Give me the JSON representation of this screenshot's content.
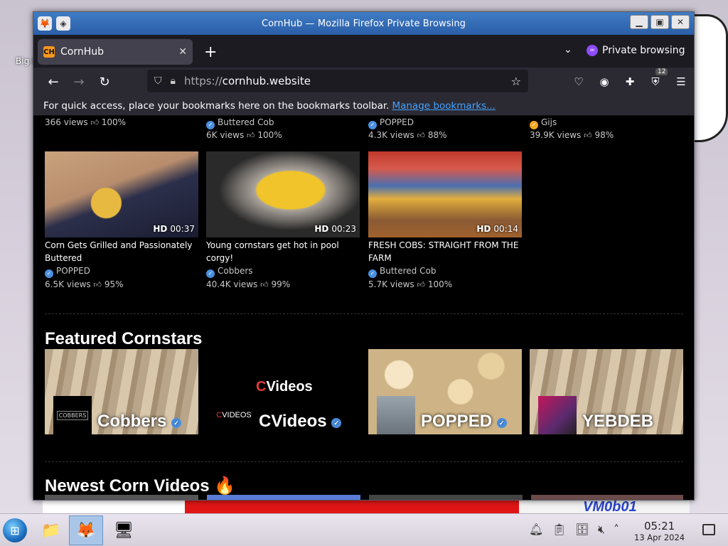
{
  "window": {
    "title": "CornHub — Mozilla Firefox Private Browsing"
  },
  "tab": {
    "title": "CornHub",
    "favicon": "CH"
  },
  "browser": {
    "url_scheme": "https://",
    "url_host": "cornhub.website",
    "private_label": "Private browsing",
    "extension_badge": "12",
    "bookmarks_hint": "For quick access, place your bookmarks here on the bookmarks toolbar.",
    "bookmarks_link": "Manage bookmarks..."
  },
  "top_row": [
    {
      "channel": "",
      "views": "366 views",
      "rating": "100%"
    },
    {
      "channel": "Buttered Cob",
      "views": "6K views",
      "rating": "100%"
    },
    {
      "channel": "POPPED",
      "views": "4.3K views",
      "rating": "88%"
    },
    {
      "channel": "Gijs",
      "views": "39.9K views",
      "rating": "98%"
    }
  ],
  "videos": [
    {
      "title": "Corn Gets Grilled and Passionately Buttered",
      "quality": "HD",
      "duration": "00:37",
      "channel": "POPPED",
      "views": "6.5K views",
      "rating": "95%"
    },
    {
      "title": "Young cornstars get hot in pool corgy!",
      "quality": "HD",
      "duration": "00:23",
      "channel": "Cobbers",
      "views": "40.4K views",
      "rating": "99%"
    },
    {
      "title": "FRESH COBS: STRAIGHT FROM THE FARM",
      "quality": "HD",
      "duration": "00:14",
      "channel": "Buttered Cob",
      "views": "5.7K views",
      "rating": "100%"
    }
  ],
  "sections": {
    "featured": "Featured Cornstars",
    "newest": "Newest Corn Videos 🔥"
  },
  "cornstars": [
    {
      "name": "Cobbers",
      "avatar_text": "COBBERS"
    },
    {
      "name": "CVideos",
      "logo_c": "C",
      "logo_rest": "Videos",
      "avatar_c": "C",
      "avatar_rest": "VIDEOS"
    },
    {
      "name": "POPPED"
    },
    {
      "name": "YEBDEB"
    }
  ],
  "desktop": {
    "icon_label": "Big De",
    "watermark": "VM0b01"
  },
  "taskbar": {
    "time": "05:21",
    "date": "13 Apr 2024"
  },
  "colors": {
    "accent_link": "#45a1ff",
    "verified": "#4a90e2",
    "page_bg": "#000000"
  }
}
